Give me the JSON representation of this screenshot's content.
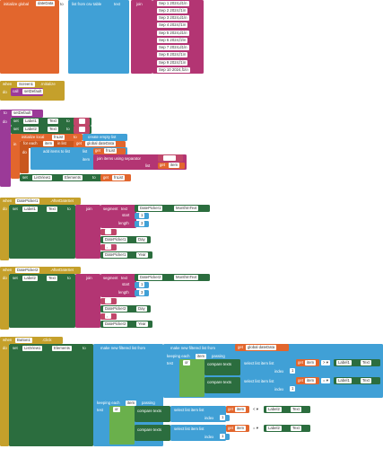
{
  "block1": {
    "initialize_global": "initialize global",
    "var_name": "dateData",
    "to": "to",
    "list_from_csv": "list from csv table",
    "text": "text",
    "join": "join",
    "dates": [
      "Sep 1 2024,d1\\n",
      "Sep 2 2024,f1\\n",
      "Sep 3 2024,d1\\n",
      "Sep 4 2024,f1\\n",
      "Sep 5 2024,d1\\n",
      "Sep 6 2024,f2\\n",
      "Sep 7 2024,d1\\n",
      "Sep 8 2024,f1\\n",
      "Sep 9 2024,f1\\n",
      "Sep 10 2024,f1\\n"
    ]
  },
  "block2": {
    "when": "when",
    "component": "Screen1",
    "event": ".Initialize",
    "do": "do",
    "call": "call",
    "proc": "setDefault"
  },
  "block3": {
    "to": "to",
    "proc": "setDefault",
    "do": "do",
    "set1": "set",
    "label1": "Label1",
    "text_prop": "Text",
    "to1": "to",
    "set2": "set",
    "label2": "Label2",
    "init_local": "initialize local",
    "local_var": "fnList",
    "create_empty": "create empty list",
    "in": "in",
    "for_each": "for each",
    "item": "item",
    "in_list": "in list",
    "get": "get",
    "global_dateData": "global dateData",
    "add_items": "add items to list",
    "list": "list",
    "get_fnList": "fnList",
    "item_label": "item",
    "join_sep": "join items using separator",
    "list_label": "list",
    "get_item": "item",
    "set3": "set",
    "listview": "ListView1",
    "elements": "Elements",
    "to3": "to",
    "get_fnList2": "fnList"
  },
  "block4": {
    "when": "when",
    "component": "DatePicker1",
    "event": ".AfterDateSet",
    "do": "do",
    "set": "set",
    "label": "Label1",
    "text_prop": "Text",
    "to": "to",
    "join": "join",
    "segment": "segment",
    "text": "text",
    "picker": "DatePicker1",
    "month_text": "MonthInText",
    "start": "start",
    "start_val": "1",
    "length": "length",
    "length_val": "3",
    "space": " ",
    "day": "Day",
    "comma_space": ", ",
    "year": "Year"
  },
  "block5": {
    "when": "when",
    "component": "DatePicker2",
    "event": ".AfterDateSet",
    "do": "do",
    "set": "set",
    "label": "Label2",
    "text_prop": "Text",
    "to": "to",
    "join": "join",
    "segment": "segment",
    "text": "text",
    "picker": "DatePicker2",
    "month_text": "MonthInText",
    "start": "start",
    "start_val": "1",
    "length": "length",
    "length_val": "3",
    "space": " ",
    "day": "Day",
    "comma_space": ", ",
    "year": "Year"
  },
  "block6": {
    "when": "when",
    "component": "Button1",
    "event": ".Click",
    "do": "do",
    "set": "set",
    "listview": "ListView1",
    "elements": "Elements",
    "to": "to",
    "make_filtered": "make new filtered list from",
    "get": "get",
    "global_dateData": "global dateData",
    "keeping_each": "keeping each",
    "item": "item",
    "passing": "passing",
    "test": "test",
    "or": "or",
    "compare_texts": "compare texts",
    "select_item": "select list item list",
    "index": "index",
    "index_val": "1",
    "gt": "> ▾",
    "eq": "= ▾",
    "lt": "< ▾",
    "label1": "Label1",
    "label2": "Label2",
    "text_prop": "Text"
  }
}
